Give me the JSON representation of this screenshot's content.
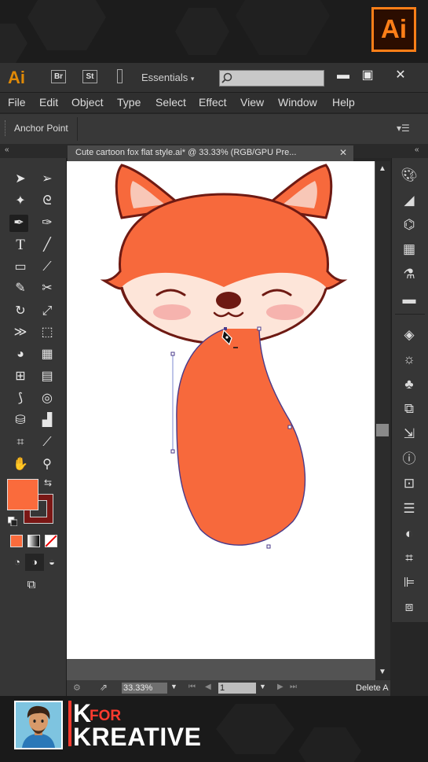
{
  "brand_badge": {
    "text": "Ai"
  },
  "app_bar": {
    "logo": "Ai",
    "bridge_button": "Br",
    "stock_button": "St",
    "workspace": "Essentials",
    "minimize": "▬",
    "maximize": "▣",
    "close": "✕"
  },
  "menu": [
    "File",
    "Edit",
    "Object",
    "Type",
    "Select",
    "Effect",
    "View",
    "Window",
    "Help"
  ],
  "control_bar": {
    "label": "Anchor Point"
  },
  "document": {
    "tab_title": "Cute cartoon fox flat style.ai* @ 33.33% (RGB/GPU Pre...",
    "close": "✕"
  },
  "status_bar": {
    "zoom": "33.33%",
    "page": "1",
    "status_text": "Delete A"
  },
  "colors": {
    "fill": "#fa6b3c",
    "stroke": "#7a1715",
    "fox_orange": "#f7693c",
    "fox_outline": "#6e1a13",
    "face_cream": "#fde5d9",
    "cheek_pink": "#f6b3ae",
    "ear_inner": "#f8c7b7",
    "accent": "#ff7f18"
  },
  "footer_brand": {
    "k": "K",
    "for": "FOR",
    "name": "KREATIVE"
  }
}
